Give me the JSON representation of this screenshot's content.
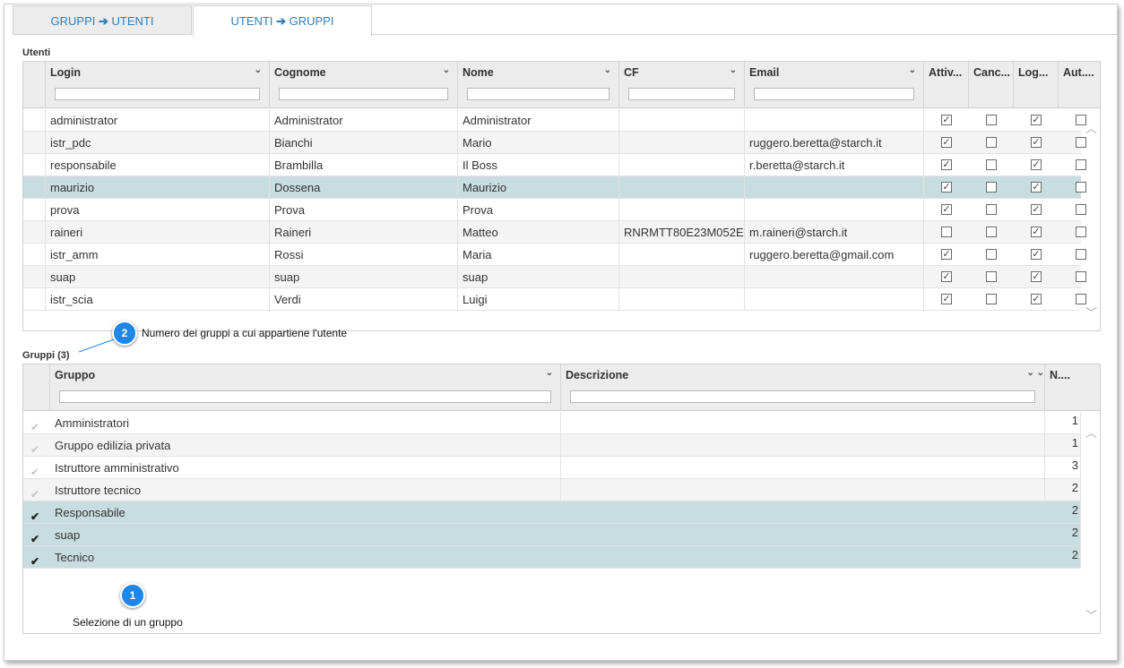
{
  "tabs": [
    {
      "label_a": "GRUPPI",
      "label_b": "UTENTI",
      "active": false
    },
    {
      "label_a": "UTENTI",
      "label_b": "GRUPPI",
      "active": true
    }
  ],
  "users": {
    "section_title": "Utenti",
    "columns": [
      "Login",
      "Cognome",
      "Nome",
      "CF",
      "Email",
      "Attiv...",
      "Canc...",
      "Log...",
      "Aut...."
    ],
    "rows": [
      {
        "login": "administrator",
        "cognome": "Administrator",
        "nome": "Administrator",
        "cf": "",
        "email": "",
        "attivo": true,
        "canc": false,
        "log": true,
        "aut": false
      },
      {
        "login": "istr_pdc",
        "cognome": "Bianchi",
        "nome": "Mario",
        "cf": "",
        "email": "ruggero.beretta@starch.it",
        "attivo": true,
        "canc": false,
        "log": true,
        "aut": false
      },
      {
        "login": "responsabile",
        "cognome": "Brambilla",
        "nome": "Il Boss",
        "cf": "",
        "email": "r.beretta@starch.it",
        "attivo": true,
        "canc": false,
        "log": true,
        "aut": false
      },
      {
        "login": "maurizio",
        "cognome": "Dossena",
        "nome": "Maurizio",
        "cf": "",
        "email": "",
        "attivo": true,
        "canc": false,
        "log": true,
        "aut": false
      },
      {
        "login": "prova",
        "cognome": "Prova",
        "nome": "Prova",
        "cf": "",
        "email": "",
        "attivo": true,
        "canc": false,
        "log": true,
        "aut": false
      },
      {
        "login": "raineri",
        "cognome": "Raineri",
        "nome": "Matteo",
        "cf": "RNRMTT80E23M052E",
        "email": "m.raineri@starch.it",
        "attivo": false,
        "canc": false,
        "log": true,
        "aut": false
      },
      {
        "login": "istr_amm",
        "cognome": "Rossi",
        "nome": "Maria",
        "cf": "",
        "email": "ruggero.beretta@gmail.com",
        "attivo": true,
        "canc": false,
        "log": true,
        "aut": false
      },
      {
        "login": "suap",
        "cognome": "suap",
        "nome": "suap",
        "cf": "",
        "email": "",
        "attivo": true,
        "canc": false,
        "log": true,
        "aut": false
      },
      {
        "login": "istr_scia",
        "cognome": "Verdi",
        "nome": "Luigi",
        "cf": "",
        "email": "",
        "attivo": true,
        "canc": false,
        "log": true,
        "aut": false
      }
    ],
    "selected_row": 3
  },
  "groups": {
    "section_title": "Gruppi (3)",
    "columns": [
      "Gruppo",
      "Descrizione",
      "N...."
    ],
    "rows": [
      {
        "name": "Amministratori",
        "desc": "",
        "n": "1",
        "checked": false
      },
      {
        "name": "Gruppo edilizia privata",
        "desc": "",
        "n": "1",
        "checked": false
      },
      {
        "name": "Istruttore amministrativo",
        "desc": "",
        "n": "3",
        "checked": false
      },
      {
        "name": "Istruttore tecnico",
        "desc": "",
        "n": "2",
        "checked": false
      },
      {
        "name": "Responsabile",
        "desc": "",
        "n": "2",
        "checked": true
      },
      {
        "name": "suap",
        "desc": "",
        "n": "2",
        "checked": true
      },
      {
        "name": "Tecnico",
        "desc": "",
        "n": "2",
        "checked": true
      }
    ]
  },
  "callouts": [
    {
      "number": "2",
      "text": "Numero dei gruppi a cui appartiene l'utente"
    },
    {
      "number": "1",
      "text": "Selezione di un gruppo"
    }
  ],
  "colors": {
    "accent": "#2f7fb8",
    "selected_row": "#c8dde0",
    "badge": "#1e86e8"
  }
}
